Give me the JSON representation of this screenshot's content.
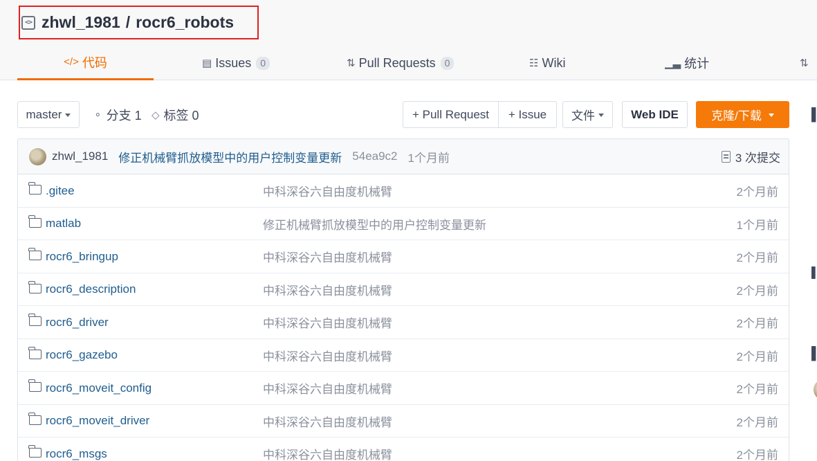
{
  "repo": {
    "owner": "zhwl_1981",
    "separator": "/",
    "name": "rocr6_robots"
  },
  "tabs": [
    {
      "label": "代码",
      "icon": "code-icon",
      "active": true
    },
    {
      "label": "Issues",
      "icon": "issues-icon",
      "count": "0"
    },
    {
      "label": "Pull Requests",
      "icon": "pull-request-icon",
      "count": "0"
    },
    {
      "label": "Wiki",
      "icon": "book-icon"
    },
    {
      "label": "统计",
      "icon": "bar-chart-icon"
    }
  ],
  "toolbar": {
    "branch": "master",
    "branches_label": "分支 1",
    "tags_label": "标签 0",
    "new_pr_label": "+ Pull Request",
    "new_issue_label": "+ Issue",
    "file_menu_label": "文件",
    "web_ide_label": "Web IDE",
    "clone_label": "克隆/下载"
  },
  "latest_commit": {
    "author": "zhwl_1981",
    "message": "修正机械臂抓放模型中的用户控制变量更新",
    "sha": "54ea9c2",
    "time": "1个月前",
    "commit_count_label": "3 次提交"
  },
  "files": [
    {
      "name": ".gitee",
      "message": "中科深谷六自由度机械臂",
      "time": "2个月前"
    },
    {
      "name": "matlab",
      "message": "修正机械臂抓放模型中的用户控制变量更新",
      "time": "1个月前"
    },
    {
      "name": "rocr6_bringup",
      "message": "中科深谷六自由度机械臂",
      "time": "2个月前"
    },
    {
      "name": "rocr6_description",
      "message": "中科深谷六自由度机械臂",
      "time": "2个月前"
    },
    {
      "name": "rocr6_driver",
      "message": "中科深谷六自由度机械臂",
      "time": "2个月前"
    },
    {
      "name": "rocr6_gazebo",
      "message": "中科深谷六自由度机械臂",
      "time": "2个月前"
    },
    {
      "name": "rocr6_moveit_config",
      "message": "中科深谷六自由度机械臂",
      "time": "2个月前"
    },
    {
      "name": "rocr6_moveit_driver",
      "message": "中科深谷六自由度机械臂",
      "time": "2个月前"
    },
    {
      "name": "rocr6_msgs",
      "message": "中科深谷六自由度机械臂",
      "time": "2个月前"
    }
  ],
  "colors": {
    "accent": "#f57a0a",
    "active_tab": "#f06c00",
    "link": "#1f5d8f",
    "highlight_border": "#e02020"
  }
}
